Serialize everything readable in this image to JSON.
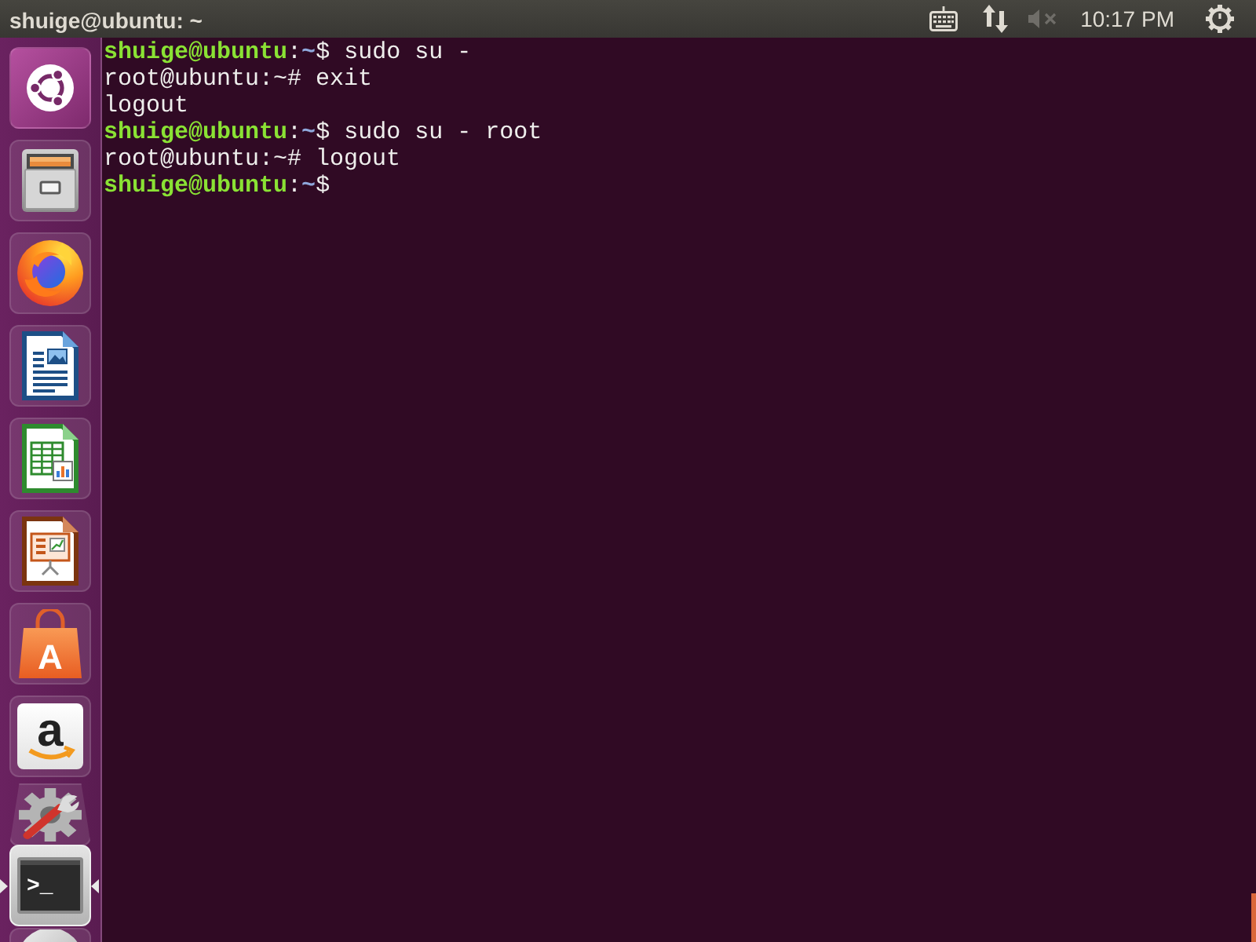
{
  "top_panel": {
    "title": "shuige@ubuntu: ~",
    "indicators": [
      {
        "kind": "keyboard"
      },
      {
        "kind": "network"
      },
      {
        "kind": "volume",
        "muted": true
      },
      {
        "kind": "clock",
        "text": "10:17 PM"
      },
      {
        "kind": "session"
      }
    ]
  },
  "launcher": {
    "items": [
      {
        "kind": "dash",
        "running": false,
        "selected": false,
        "folded": false,
        "clipped": false
      },
      {
        "kind": "files",
        "running": false,
        "selected": false,
        "folded": false,
        "clipped": false
      },
      {
        "kind": "browser",
        "running": false,
        "selected": false,
        "folded": false,
        "clipped": false
      },
      {
        "kind": "writer",
        "running": false,
        "selected": false,
        "folded": false,
        "clipped": false
      },
      {
        "kind": "spreadsheet",
        "running": false,
        "selected": false,
        "folded": false,
        "clipped": false
      },
      {
        "kind": "presentation",
        "running": false,
        "selected": false,
        "folded": false,
        "clipped": false
      },
      {
        "kind": "software",
        "glyph": "A",
        "running": false,
        "selected": false,
        "folded": false,
        "clipped": false
      },
      {
        "kind": "shop",
        "glyph": "a",
        "running": false,
        "selected": false,
        "folded": false,
        "clipped": false
      },
      {
        "kind": "settings",
        "running": false,
        "selected": false,
        "folded": true,
        "clipped": false
      },
      {
        "kind": "terminal",
        "glyph": ">_",
        "running": true,
        "selected": true,
        "folded": false,
        "clipped": false
      },
      {
        "kind": "disc",
        "running": false,
        "selected": false,
        "folded": false,
        "clipped": true
      }
    ]
  },
  "terminal": {
    "lines": [
      {
        "segments": [
          {
            "kind": "user",
            "text": "shuige@ubuntu"
          },
          {
            "kind": "plain",
            "text": ":"
          },
          {
            "kind": "path",
            "text": "~"
          },
          {
            "kind": "plain",
            "text": "$ sudo su -"
          }
        ]
      },
      {
        "segments": [
          {
            "kind": "plain",
            "text": "root@ubuntu:~# exit"
          }
        ]
      },
      {
        "segments": [
          {
            "kind": "plain",
            "text": "logout"
          }
        ]
      },
      {
        "segments": [
          {
            "kind": "user",
            "text": "shuige@ubuntu"
          },
          {
            "kind": "plain",
            "text": ":"
          },
          {
            "kind": "path",
            "text": "~"
          },
          {
            "kind": "plain",
            "text": "$ sudo su - root"
          }
        ]
      },
      {
        "segments": [
          {
            "kind": "plain",
            "text": "root@ubuntu:~# logout"
          }
        ]
      },
      {
        "segments": [
          {
            "kind": "user",
            "text": "shuige@ubuntu"
          },
          {
            "kind": "plain",
            "text": ":"
          },
          {
            "kind": "path",
            "text": "~"
          },
          {
            "kind": "plain",
            "text": "$"
          }
        ]
      }
    ]
  }
}
